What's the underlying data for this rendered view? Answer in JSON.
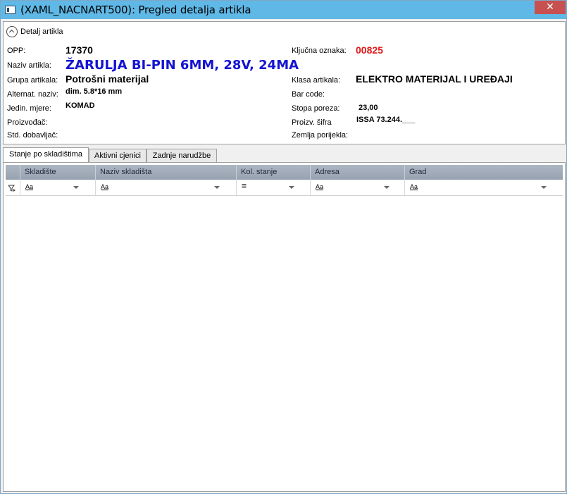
{
  "window": {
    "title": "(XAML_NACNART500): Pregled detalja artikla",
    "close_label": "✕"
  },
  "panel": {
    "title": "Detalj artikla"
  },
  "fields_left": [
    {
      "label": "OPP:",
      "value": "17370"
    },
    {
      "label": "Naziv artikla:",
      "value": "ŽARULJA BI-PIN 6MM, 28V, 24MA"
    },
    {
      "label": "Grupa artikala:",
      "value": "Potrošni materijal"
    },
    {
      "label": "Alternat. naziv:",
      "value": "dim. 5.8*16 mm"
    },
    {
      "label": "Jedin. mjere:",
      "value": "KOMAD"
    },
    {
      "label": "Proizvođač:",
      "value": ""
    },
    {
      "label": "Std. dobavljač:",
      "value": ""
    }
  ],
  "fields_right": [
    {
      "label": "Ključna oznaka:",
      "value": "00825"
    },
    {
      "label": "Klasa artikala:",
      "value": "ELEKTRO MATERIJAL I UREĐAJI"
    },
    {
      "label": "Bar code:",
      "value": ""
    },
    {
      "label": "Stopa poreza:",
      "value": "23,00"
    },
    {
      "label": "Proizv. šifra",
      "value": "ISSA 73.244.___"
    },
    {
      "label": "Zemlja porijekla:",
      "value": ""
    }
  ],
  "tabs": [
    "Stanje po skladištima",
    "Aktivni cjenici",
    "Zadnje narudžbe"
  ],
  "grid": {
    "columns": [
      "Skladište",
      "Naziv skladišta",
      "Kol. stanje",
      "Adresa",
      "Grad"
    ],
    "filter_ops": [
      "Aa",
      "Aa",
      "=",
      "Aa",
      "Aa"
    ]
  },
  "colors": {
    "title_bar": "#5fb8e6",
    "name_value": "#1414d2",
    "key_value": "#e01818"
  }
}
